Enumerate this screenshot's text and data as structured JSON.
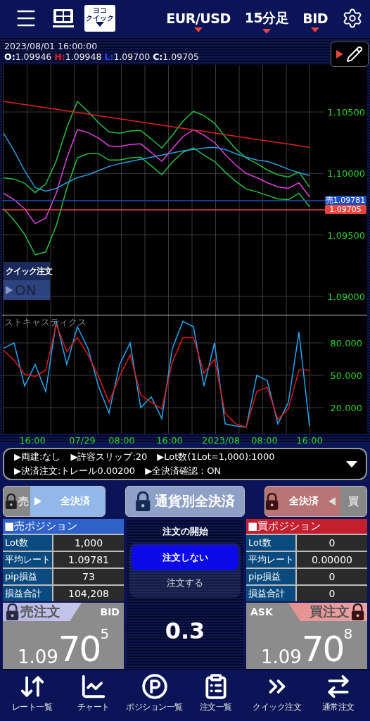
{
  "toolbar": {
    "badge_lines": [
      "ヨコ",
      "クイック"
    ],
    "symbol": "EUR/USD",
    "timeframe": "15分足",
    "price_type": "BID"
  },
  "chart": {
    "datetime": "2023/08/01  16:00:00",
    "ohlc": [
      {
        "kind": "open",
        "label": "O:",
        "value": "1.09946"
      },
      {
        "kind": "high",
        "label": "H:",
        "value": "1.09948"
      },
      {
        "kind": "low",
        "label": "L:",
        "value": "1.09700"
      },
      {
        "kind": "close",
        "label": "C:",
        "value": "1.09705"
      }
    ],
    "tags": [
      {
        "text": "売1.09781",
        "color": "#1f4fc0"
      },
      {
        "text": "1.09705",
        "color": "#e8453c"
      }
    ],
    "quick_order": {
      "label": "クイック注文",
      "value": "ON"
    },
    "chart_data": {
      "type": "line",
      "grid": true,
      "ylim": [
        1.08851,
        1.10884
      ],
      "yticks": [
        {
          "value": 1.105,
          "label": "1.10500"
        },
        {
          "value": 1.1,
          "label": "1.10000"
        },
        {
          "value": 1.095,
          "label": "1.09500"
        },
        {
          "value": 1.09,
          "label": "1.09000"
        }
      ],
      "series": [
        {
          "color": "#e040e0",
          "values": [
            1.09839,
            1.09787,
            1.09713,
            1.09592,
            1.09638,
            1.09839,
            1.10126,
            1.10356,
            1.10333,
            1.10287,
            1.10224,
            1.10218,
            1.10236,
            1.10241,
            1.10172,
            1.10098,
            1.10201,
            1.10299,
            1.10356,
            1.1031,
            1.10253,
            1.10155,
            1.10069,
            1.1,
            1.09966,
            1.09925,
            1.09891,
            1.09879,
            1.09925,
            1.0981
          ]
        },
        {
          "color": "#22c040",
          "values": [
            1.09965,
            1.09954,
            1.0992,
            1.09845,
            1.09914,
            1.10103,
            1.10373,
            1.10586,
            1.10505,
            1.10413,
            1.10339,
            1.10327,
            1.10345,
            1.1035,
            1.10281,
            1.10207,
            1.1031,
            1.10425,
            1.10505,
            1.10471,
            1.10408,
            1.10299,
            1.10201,
            1.10126,
            1.10081,
            1.10028,
            1.09989,
            1.09971,
            1.10011,
            1.0989
          ]
        },
        {
          "color": "#22c040",
          "values": [
            1.09713,
            1.0962,
            1.09506,
            1.09339,
            1.09362,
            1.09575,
            1.09879,
            1.10126,
            1.10161,
            1.10161,
            1.10109,
            1.10109,
            1.10127,
            1.10132,
            1.10063,
            1.09989,
            1.10092,
            1.10173,
            1.10207,
            1.10149,
            1.10098,
            1.10011,
            1.09937,
            1.09874,
            1.09851,
            1.09822,
            1.09793,
            1.09787,
            1.09839,
            1.0973
          ]
        },
        {
          "color": "#e02020",
          "values": [
            1.10586,
            1.10573,
            1.1056,
            1.10547,
            1.10535,
            1.10522,
            1.10509,
            1.10496,
            1.10483,
            1.1047,
            1.10457,
            1.10445,
            1.10432,
            1.10419,
            1.10406,
            1.10393,
            1.1038,
            1.10367,
            1.10354,
            1.10342,
            1.10329,
            1.10316,
            1.10303,
            1.1029,
            1.10277,
            1.10264,
            1.10252,
            1.10239,
            1.10226,
            1.10213
          ]
        },
        {
          "color": "#2a9ae0",
          "values": [
            1.10328,
            1.10184,
            1.10023,
            1.09885,
            1.09856,
            1.09879,
            1.09925,
            1.09966,
            1.09989,
            1.10023,
            1.10057,
            1.1008,
            1.10098,
            1.10115,
            1.10132,
            1.10149,
            1.10167,
            1.10184,
            1.10195,
            1.10207,
            1.10213,
            1.10195,
            1.10161,
            1.10132,
            1.10109,
            1.10098,
            1.10069,
            1.10034,
            1.10006,
            1.09983
          ]
        }
      ]
    }
  },
  "stochastic": {
    "name": "ストキャスティクス",
    "time_labels": [
      "16:00",
      "07/29",
      "08:00",
      "16:00",
      "2023/08",
      "08:00",
      "16:00"
    ],
    "chart_data": {
      "type": "line",
      "grid": true,
      "ylim": [
        -4.1,
        106.1
      ],
      "yticks": [
        {
          "value": 80,
          "label": "80.000"
        },
        {
          "value": 50,
          "label": "50.000"
        },
        {
          "value": 20,
          "label": "20.000"
        }
      ],
      "series": [
        {
          "color": "#1ea8f0",
          "values": [
            75,
            80,
            40,
            60,
            35,
            100,
            60,
            95,
            75,
            40,
            15,
            60,
            80,
            20,
            30,
            10,
            75,
            100,
            95,
            40,
            80,
            5,
            3,
            2,
            50,
            45,
            5,
            25,
            90,
            3
          ]
        },
        {
          "color": "#e01818",
          "values": [
            73,
            64,
            51,
            49,
            55,
            97,
            72,
            85,
            69,
            49,
            25,
            49,
            69,
            32,
            25,
            19,
            62,
            85,
            85,
            52,
            65,
            15,
            5,
            2,
            35,
            39,
            9,
            19,
            55,
            55
          ]
        }
      ]
    }
  },
  "settings": {
    "lines": [
      {
        "items": [
          "▶両建:なし",
          "▶許容スリップ:20",
          "▶Lot数(1Lot=1,000):1000"
        ]
      },
      {
        "items": [
          "▶決済注文:トレール0.00200",
          "▶全決済確認：ON"
        ]
      }
    ]
  },
  "close_buttons": [
    {
      "kind": "sell",
      "side": "売",
      "label": "全決済"
    },
    {
      "kind": "currency",
      "label": "通貨別全決済"
    },
    {
      "kind": "buy",
      "side": "買",
      "label": "全決済"
    }
  ],
  "sell_position": {
    "title": "■売ポジション",
    "rows": [
      {
        "label": "Lot数",
        "value": "1,000"
      },
      {
        "label": "平均レート",
        "value": "1.09781"
      },
      {
        "label": "pip損益",
        "value": "73"
      },
      {
        "label": "損益合計",
        "value": "104,208"
      }
    ]
  },
  "order_start": {
    "title": "注文の開始",
    "options": [
      {
        "label": "注文しない",
        "selected": true
      },
      {
        "label": "注文する",
        "selected": false
      }
    ],
    "spread": "0.3"
  },
  "buy_position": {
    "title": "■買ポジション",
    "rows": [
      {
        "label": "Lot数",
        "value": "0"
      },
      {
        "label": "平均レート",
        "value": "0.00000"
      },
      {
        "label": "pip損益",
        "value": "0"
      },
      {
        "label": "損益合計",
        "value": "0"
      }
    ]
  },
  "sell_order": {
    "label": "売注文",
    "price_type": "BID",
    "prefix": "1.09",
    "main": "70",
    "sup": "5"
  },
  "buy_order": {
    "label": "買注文",
    "price_type": "ASK",
    "prefix": "1.09",
    "main": "70",
    "sup": "8"
  },
  "tabs": [
    {
      "kind": "rates",
      "label": "レート一覧"
    },
    {
      "kind": "chart",
      "label": "チャート"
    },
    {
      "kind": "positions",
      "label": "ポジション一覧"
    },
    {
      "kind": "orders",
      "label": "注文一覧"
    },
    {
      "kind": "quick",
      "label": "クイック注文"
    },
    {
      "kind": "normal",
      "label": "通常注文"
    }
  ]
}
